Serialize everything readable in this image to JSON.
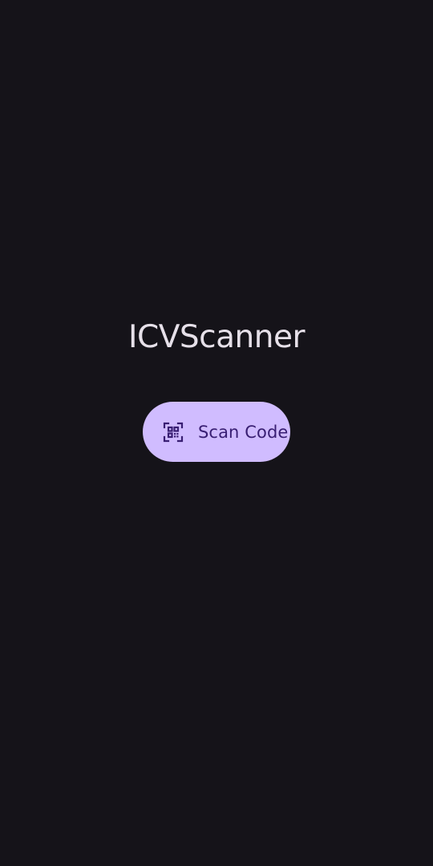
{
  "app": {
    "title": "ICVScanner"
  },
  "scan_button": {
    "label": "Scan Code",
    "icon": "qr-code-scanner-icon"
  },
  "colors": {
    "background": "#151319",
    "title_text": "#e6e0e9",
    "button_background": "#d0bcff",
    "button_content": "#381e72"
  }
}
